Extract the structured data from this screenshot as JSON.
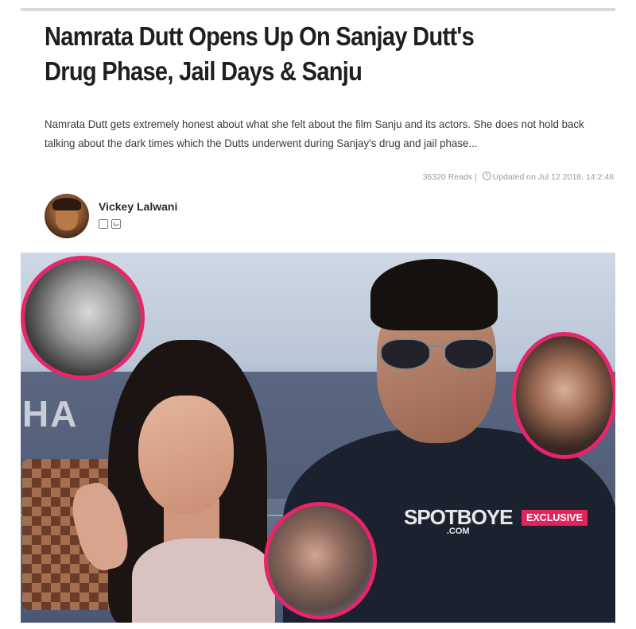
{
  "article": {
    "title": "Namrata Dutt Opens Up On Sanjay Dutt's Drug Phase, Jail Days & Sanju",
    "summary": "Namrata Dutt gets extremely honest about what she felt about the film Sanju and its actors. She does not hold back talking about the dark times which the Dutts underwent during Sanjay's drug and jail phase...",
    "reads": "36320 Reads |",
    "updated": "Updated on Jul 12 2018, 14:2:48"
  },
  "author": {
    "name": "Vickey Lalwani",
    "socials": [
      "facebook-icon",
      "twitter-icon"
    ]
  },
  "hero": {
    "wall_text": "HA",
    "brand": "SPOTBOYE",
    "brand_suffix": ".COM",
    "badge": "EXCLUSIVE"
  },
  "colors": {
    "accent": "#e8256b",
    "badge": "#e3245c"
  }
}
